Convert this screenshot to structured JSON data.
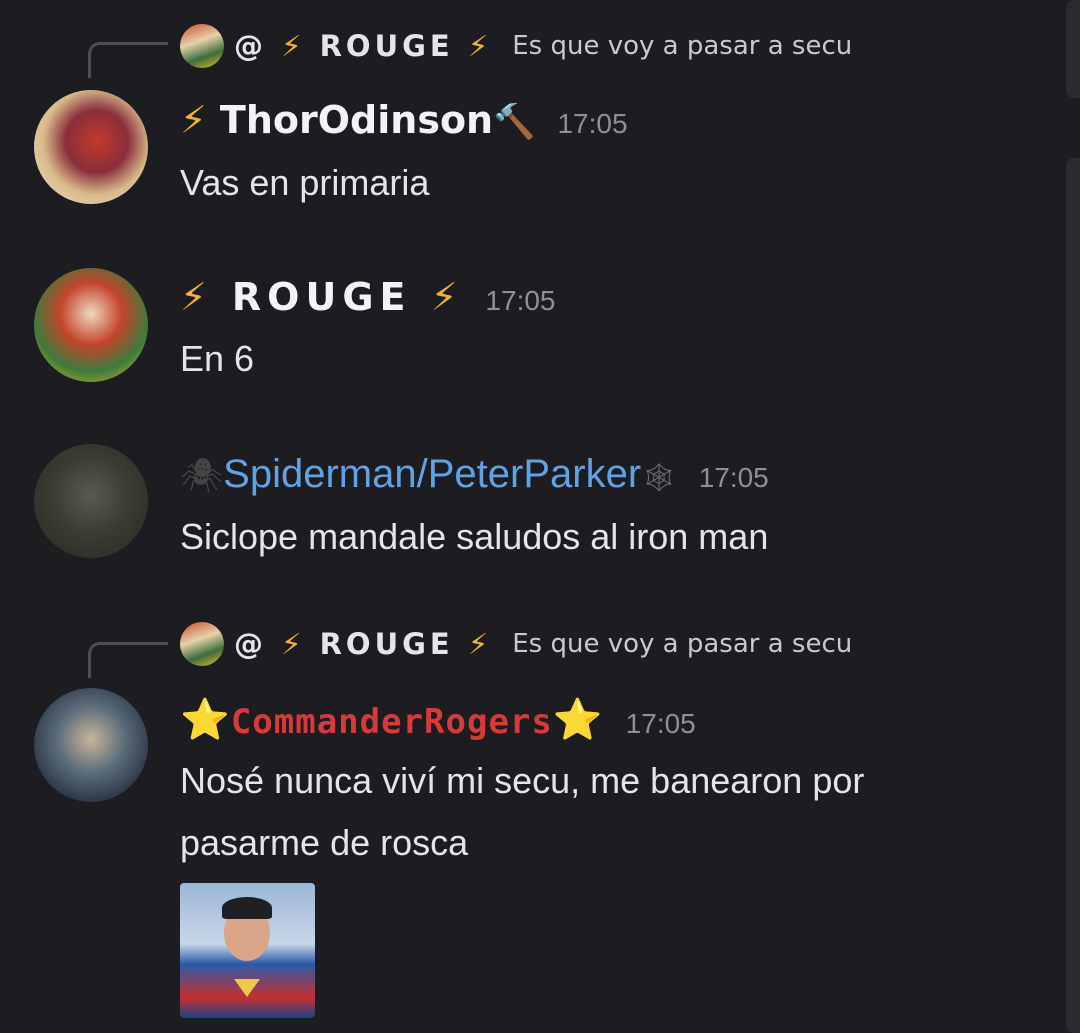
{
  "replies": [
    {
      "at": "@",
      "bolt_left": "⚡",
      "name": "ROUGE",
      "bolt_right": "⚡",
      "text": "Es que voy a pasar a secu"
    },
    {
      "at": "@",
      "bolt_left": "⚡",
      "name": "ROUGE",
      "bolt_right": "⚡",
      "text": "Es que voy a pasar a secu"
    }
  ],
  "messages": [
    {
      "prefix": "⚡",
      "name": "ThorOdinson",
      "suffix": "🔨",
      "time": "17:05",
      "lines": [
        "Vas en primaria"
      ]
    },
    {
      "prefix": "⚡",
      "name": "ROUGE",
      "suffix": "⚡",
      "time": "17:05",
      "lines": [
        "En 6"
      ]
    },
    {
      "prefix": "🕷",
      "name": "Spiderman/PeterParker",
      "suffix": "🕸",
      "time": "17:05",
      "lines": [
        "Siclope mandale saludos al iron man"
      ]
    },
    {
      "prefix": "⭐",
      "name": "CommanderRogers",
      "suffix": "⭐",
      "time": "17:05",
      "lines": [
        "Nosé nunca viví mi secu, me banearon por",
        "pasarme de rosca"
      ]
    }
  ],
  "colors": {
    "background": "#1c1c21",
    "spider_name": "#5fa2e6",
    "cap_name": "#d83a3a",
    "timestamp": "#8e9099"
  }
}
